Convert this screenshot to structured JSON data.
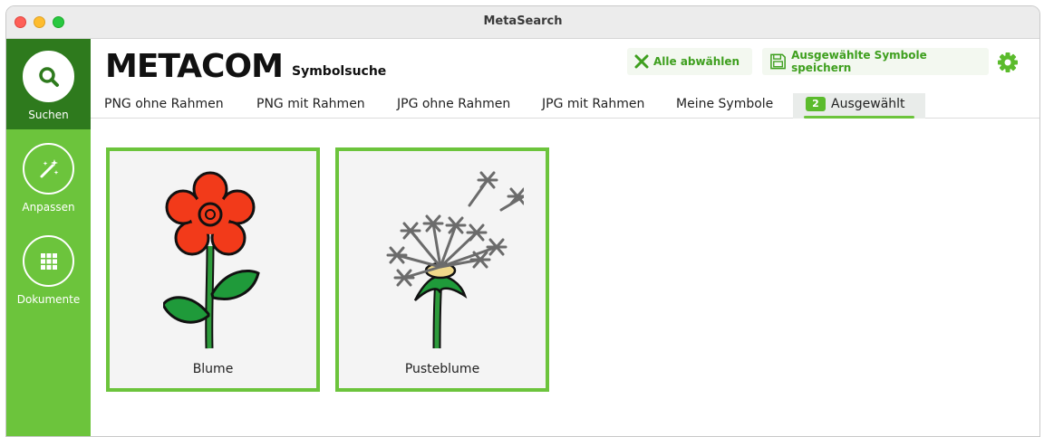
{
  "window": {
    "title": "MetaSearch"
  },
  "sidebar": {
    "items": [
      {
        "label": "Suchen",
        "icon": "search-icon",
        "active": true
      },
      {
        "label": "Anpassen",
        "icon": "magic-wand-icon",
        "active": false
      },
      {
        "label": "Dokumente",
        "icon": "grid-icon",
        "active": false
      }
    ]
  },
  "header": {
    "logo": "METACOM",
    "subtitle": "Symbolsuche",
    "deselect_label": "Alle abwählen",
    "save_label": "Ausgewählte Symbole speichern",
    "settings_icon": "gear-icon"
  },
  "tabs": [
    {
      "label": "PNG ohne Rahmen"
    },
    {
      "label": "PNG mit Rahmen"
    },
    {
      "label": "JPG ohne Rahmen"
    },
    {
      "label": "JPG mit Rahmen"
    },
    {
      "label": "Meine Symbole"
    },
    {
      "label": "Ausgewählt",
      "badge": "2",
      "selected": true
    }
  ],
  "symbols": [
    {
      "label": "Blume",
      "icon": "flower-icon"
    },
    {
      "label": "Pusteblume",
      "icon": "dandelion-icon"
    }
  ],
  "colors": {
    "accent_green": "#6cc43c",
    "active_green": "#2e7a1d",
    "action_green": "#3e9f1e",
    "flower_red": "#f23a1a"
  }
}
